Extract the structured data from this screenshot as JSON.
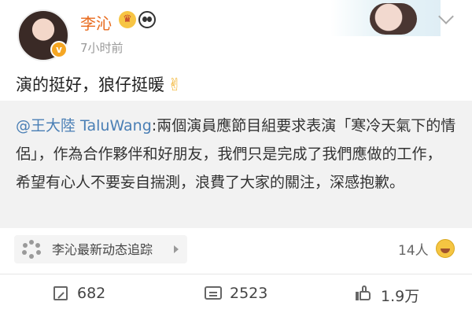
{
  "post": {
    "username": "李沁",
    "timestamp": "7小时前",
    "text": "演的挺好，狼仔挺暖",
    "victory_emoji": "✌",
    "verified_badge": "v"
  },
  "quote": {
    "mention": "@王大陸 TaluWang",
    "text": ":兩個演員應節目組要求表演「寒冷天氣下的情侶」，作為合作夥伴和好朋友，我們只是完成了我們應做的工作，希望有心人不要妄自揣測，浪費了大家的關注，深感抱歉。"
  },
  "tracking": {
    "label": "李沁最新动态追踪",
    "people_count": "14人"
  },
  "actions": {
    "reposts": "682",
    "comments": "2523",
    "likes": "1.9万"
  },
  "colors": {
    "username": "#e86a1c",
    "mention": "#4a7fb5",
    "quote_bg": "#f2f2f2"
  },
  "icons": [
    "crown-icon",
    "panda-icon",
    "chevron-down-icon",
    "victory-icon",
    "tracking-icon",
    "laugh-icon",
    "repost-icon",
    "comment-icon",
    "like-icon"
  ]
}
